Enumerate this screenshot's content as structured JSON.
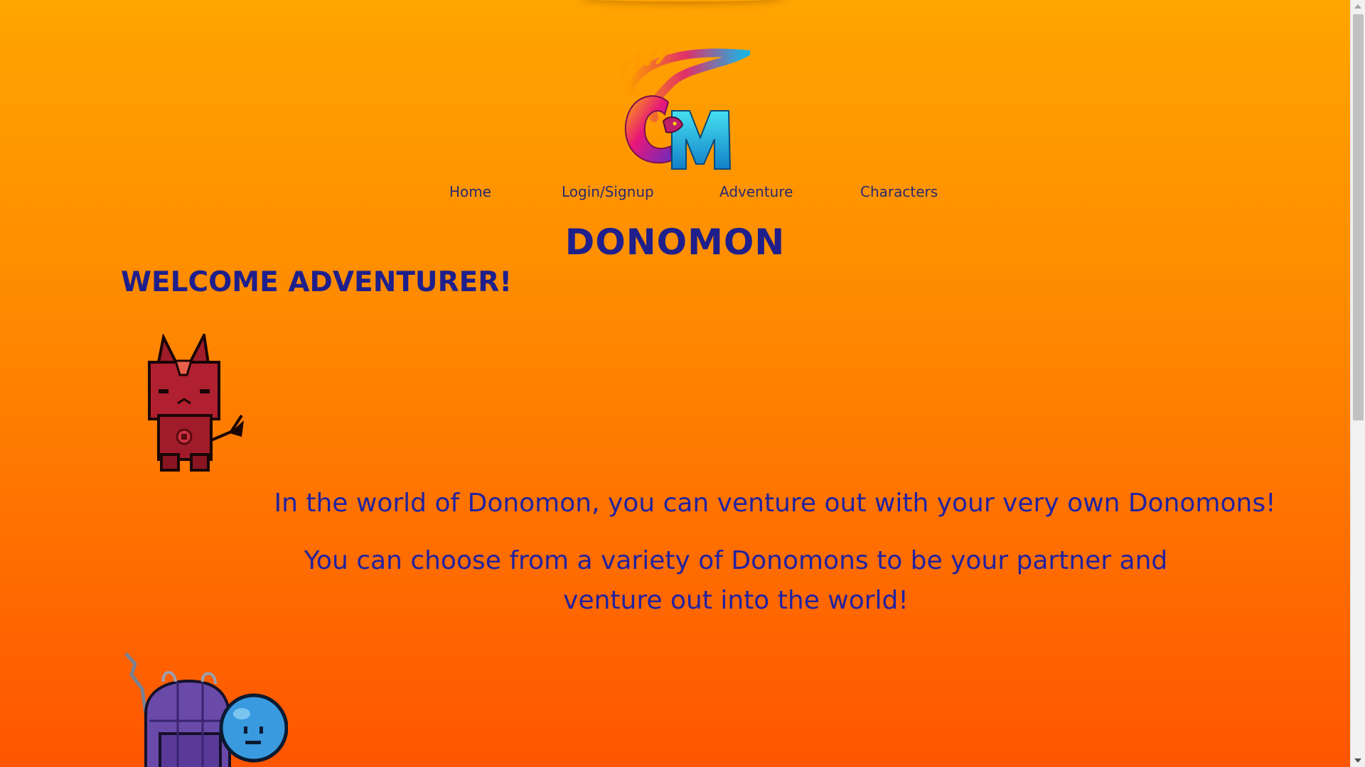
{
  "nav": {
    "items": [
      {
        "label": "Home"
      },
      {
        "label": "Login/Signup"
      },
      {
        "label": "Adventure"
      },
      {
        "label": "Characters"
      }
    ]
  },
  "header": {
    "title": "DONOMON"
  },
  "main": {
    "welcome": "WELCOME ADVENTURER!",
    "paragraphs": [
      "In the world of Donomon, you can venture out with your very own Donomons!",
      "You can choose from a variety of Donomons to be your partner and venture out into the world!"
    ]
  },
  "icons": {
    "logo": "dragon-dm-logo-icon",
    "sprite1": "red-horned-creature-icon",
    "sprite2": "purple-knight-blue-blob-icon"
  },
  "colors": {
    "background_top": "#ffa500",
    "background_bottom": "#ff5500",
    "heading": "#1f1f8c",
    "nav_text": "#2a2a6e"
  }
}
